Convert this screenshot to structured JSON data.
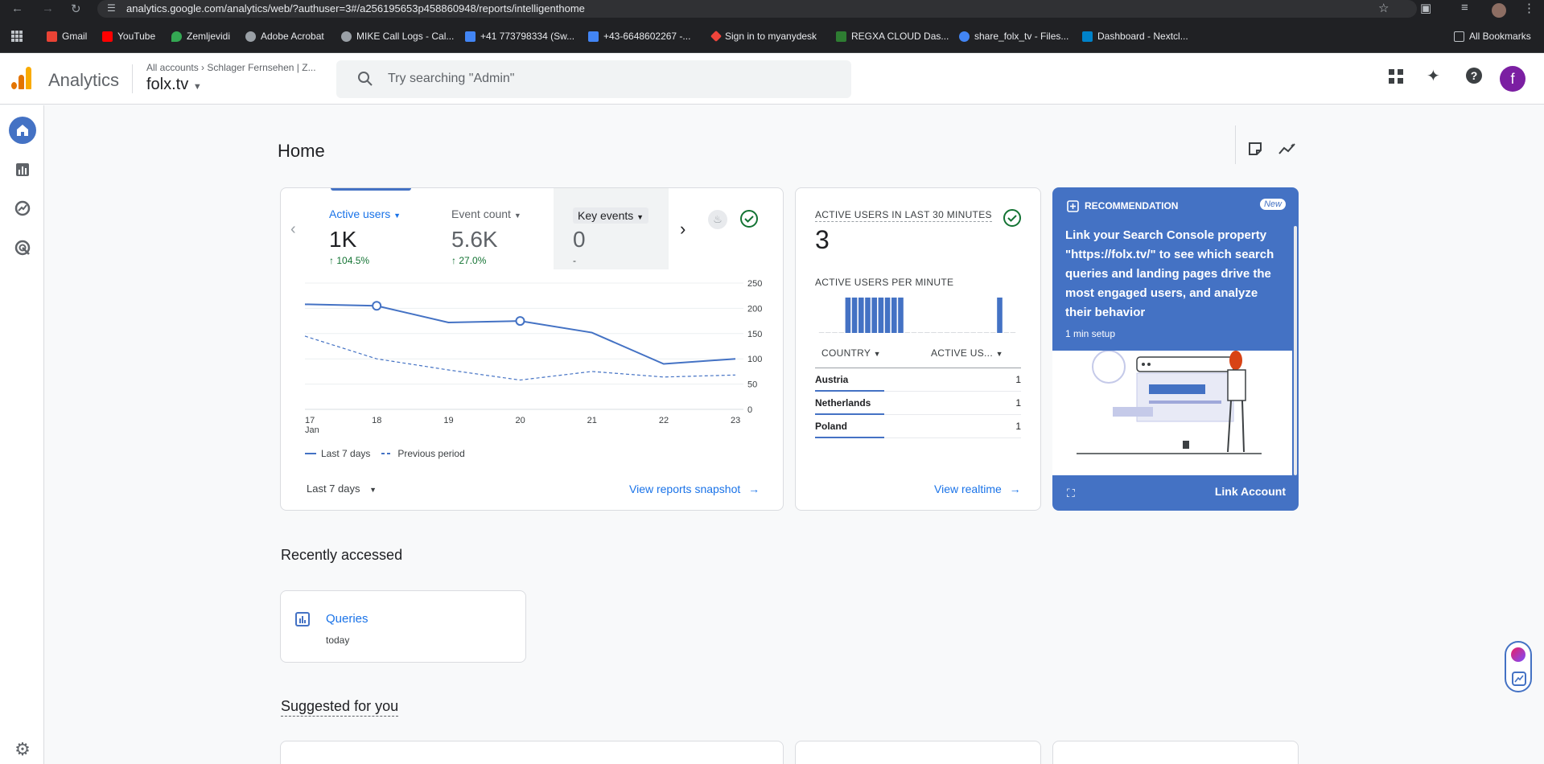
{
  "browser": {
    "url": "analytics.google.com/analytics/web/?authuser=3#/a256195653p458860948/reports/intelligenthome",
    "bookmarks": [
      "Gmail",
      "YouTube",
      "Zemljevidi",
      "Adobe Acrobat",
      "MIKE Call Logs - Cal...",
      "+41 773798334 (Sw...",
      "+43-6648602267 -...",
      "Sign in to myanydesk",
      "REGXA CLOUD Das...",
      "share_folx_tv - Files...",
      "Dashboard - Nextcl..."
    ],
    "all_bookmarks": "All Bookmarks"
  },
  "header": {
    "app_name": "Analytics",
    "breadcrumb_root": "All accounts",
    "breadcrumb_account": "Schlager Fernsehen | Z...",
    "property": "folx.tv",
    "search_placeholder": "Try searching \"Admin\"",
    "avatar_initial": "f"
  },
  "page": {
    "title": "Home"
  },
  "overview_card": {
    "metrics": [
      {
        "label": "Active users",
        "value": "1K",
        "change": "104.5%"
      },
      {
        "label": "Event count",
        "value": "5.6K",
        "change": "27.0%"
      },
      {
        "label": "Key events",
        "value": "0",
        "change": "-"
      }
    ],
    "legend_current": "Last 7 days",
    "legend_previous": "Previous period",
    "date_range": "Last 7 days",
    "link": "View reports snapshot"
  },
  "chart_data": {
    "type": "line",
    "x": [
      "17",
      "18",
      "19",
      "20",
      "21",
      "22",
      "23"
    ],
    "x_sublabel_first": "Jan",
    "series": [
      {
        "name": "Last 7 days",
        "values": [
          208,
          205,
          172,
          175,
          152,
          90,
          100
        ]
      },
      {
        "name": "Previous period",
        "values": [
          145,
          100,
          78,
          58,
          75,
          64,
          68
        ]
      }
    ],
    "y_ticks": [
      250,
      200,
      150,
      100,
      50,
      0
    ],
    "ylim": [
      0,
      250
    ]
  },
  "realtime_card": {
    "title": "ACTIVE USERS IN LAST 30 MINUTES",
    "count": "3",
    "subtitle": "ACTIVE USERS PER MINUTE",
    "per_minute": [
      0,
      0,
      0,
      0,
      1,
      1,
      1,
      1,
      1,
      1,
      1,
      1,
      1,
      0,
      0,
      0,
      0,
      0,
      0,
      0,
      0,
      0,
      0,
      0,
      0,
      0,
      0,
      1,
      0,
      0
    ],
    "col_country": "COUNTRY",
    "col_users": "ACTIVE US...",
    "rows": [
      {
        "country": "Austria",
        "users": "1"
      },
      {
        "country": "Netherlands",
        "users": "1"
      },
      {
        "country": "Poland",
        "users": "1"
      }
    ],
    "link": "View realtime"
  },
  "recommendation": {
    "label": "RECOMMENDATION",
    "badge": "New",
    "text": "Link your Search Console property \"https://folx.tv/\" to see which search queries and landing pages drive the most engaged users, and analyze their behavior",
    "setup": "1 min setup",
    "action": "Link Account"
  },
  "recent": {
    "title": "Recently accessed",
    "item_label": "Queries",
    "item_time": "today"
  },
  "suggested": {
    "title": "Suggested for you"
  },
  "colors": {
    "accent": "#4472c4",
    "link": "#1a73e8",
    "positive": "#137333",
    "avatar": "#7b1fa2"
  }
}
